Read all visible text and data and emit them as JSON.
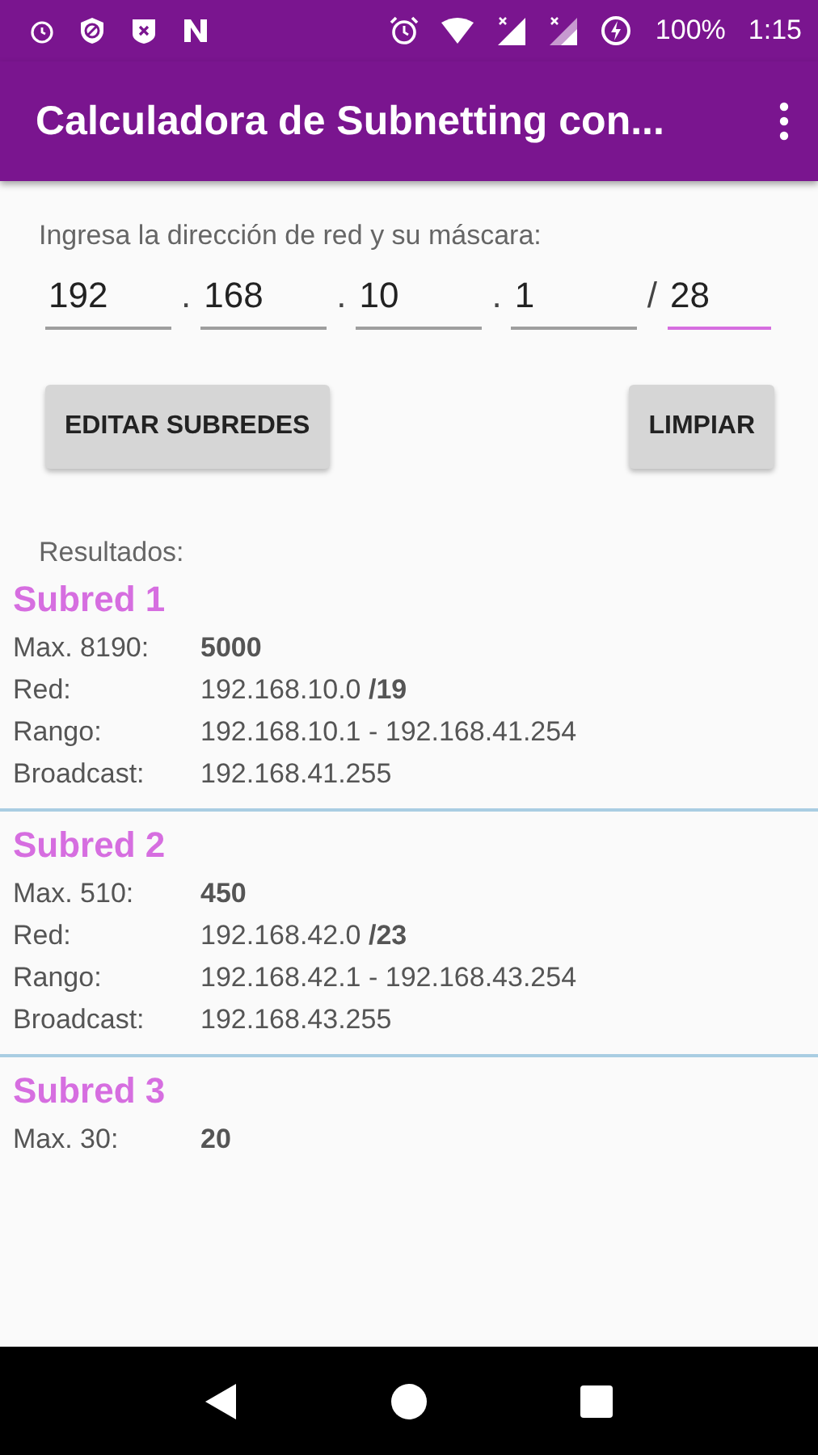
{
  "status_bar": {
    "battery": "100%",
    "time": "1:15"
  },
  "app_bar": {
    "title": "Calculadora de Subnetting con..."
  },
  "prompt": "Ingresa la dirección de red y su máscara:",
  "address_fields": [
    {
      "value": "192",
      "focused": false
    },
    {
      "value": "168",
      "separator": ".",
      "focused": false
    },
    {
      "value": "10",
      "separator": ".",
      "focused": false
    },
    {
      "value": "1",
      "separator": ".",
      "focused": false
    },
    {
      "value": "28",
      "separator": "/",
      "focused": true
    }
  ],
  "buttons": [
    "EDITAR SUBREDES",
    "LIMPIAR"
  ],
  "results_label": "Resultados:",
  "subnets": [
    {
      "title": "Subred 1",
      "rows": [
        {
          "label": "Max. 8190:",
          "value": "5000",
          "kind": "count"
        },
        {
          "label": "Red:",
          "value": "192.168.10.0 **/19**",
          "kind": "plain"
        },
        {
          "label": "Rango:",
          "value": "192.168.10.1 - 192.168.41.254",
          "kind": "plain"
        },
        {
          "label": "Broadcast:",
          "value": "192.168.41.255",
          "kind": "plain"
        }
      ]
    },
    {
      "title": "Subred 2",
      "rows": [
        {
          "label": "Max. 510:",
          "value": "450",
          "kind": "count"
        },
        {
          "label": "Red:",
          "value": "192.168.42.0 **/23**",
          "kind": "plain"
        },
        {
          "label": "Rango:",
          "value": "192.168.42.1 - 192.168.43.254",
          "kind": "plain"
        },
        {
          "label": "Broadcast:",
          "value": "192.168.43.255",
          "kind": "plain"
        }
      ]
    },
    {
      "title": "Subred 3",
      "rows": [
        {
          "label": "Max. 30:",
          "value": "20",
          "kind": "count"
        }
      ]
    }
  ]
}
